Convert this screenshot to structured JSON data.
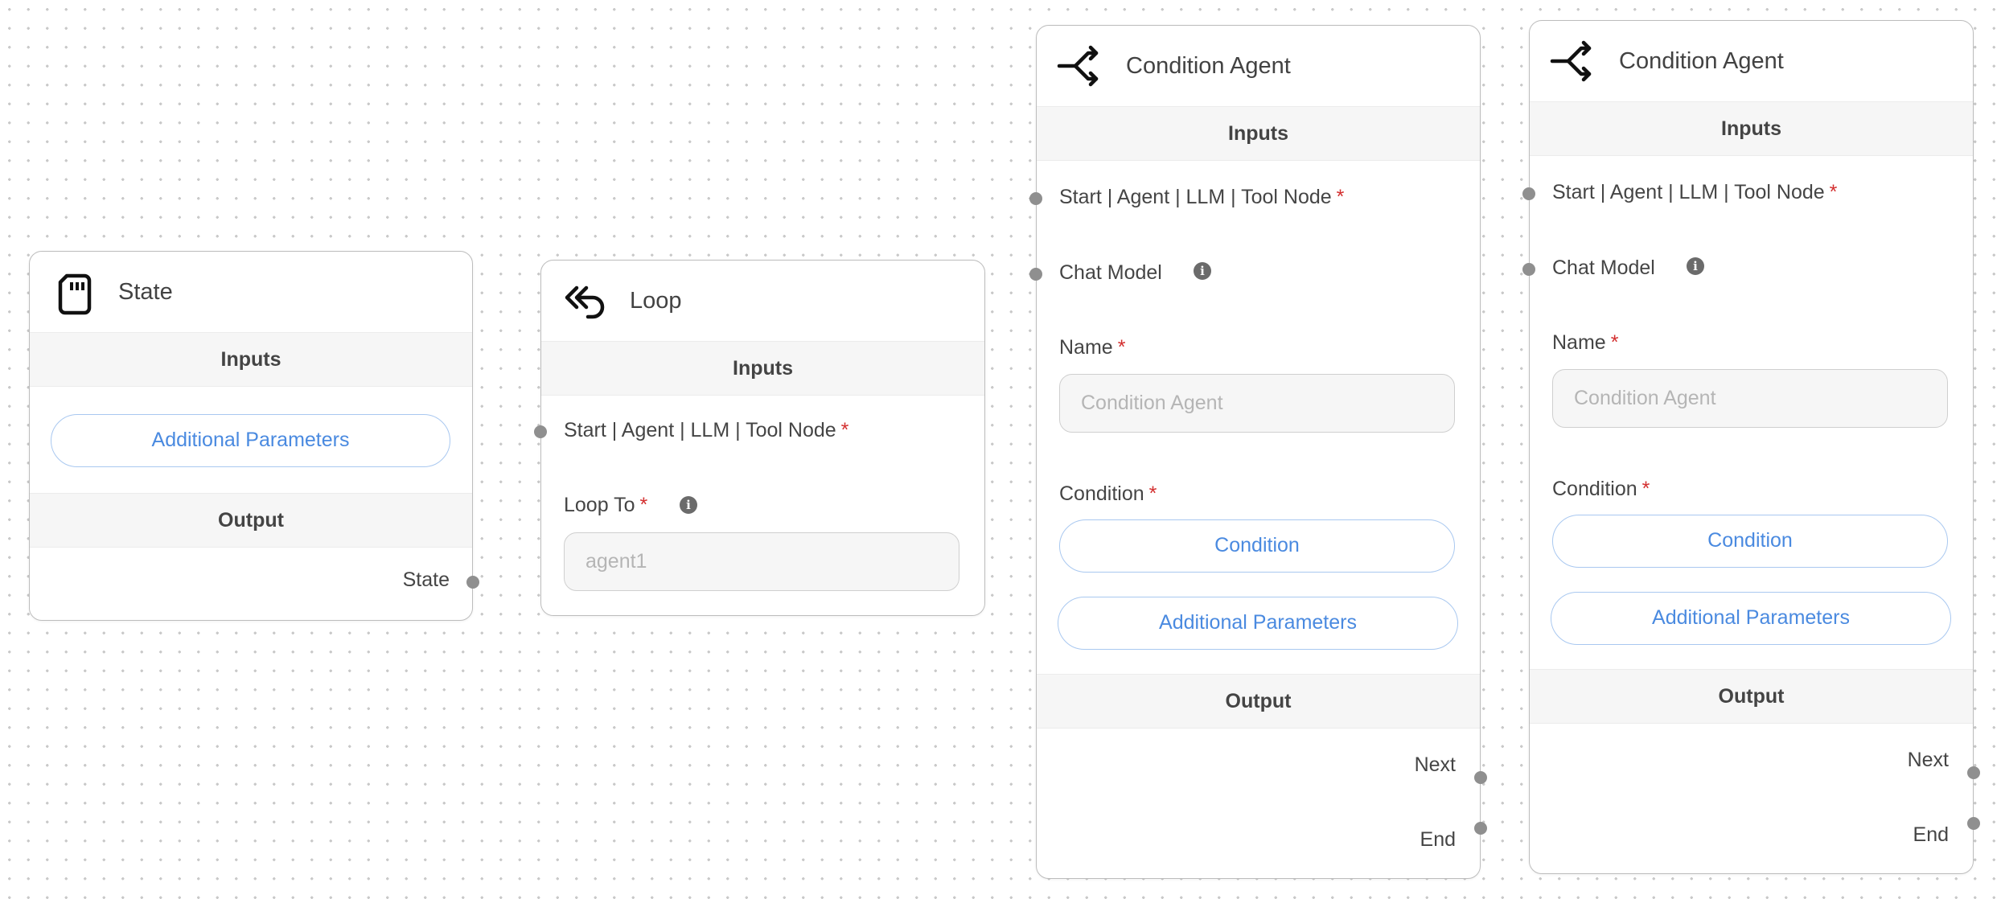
{
  "state_node": {
    "title": "State",
    "icon": "sd-card-icon",
    "inputs_header": "Inputs",
    "additional_params": "Additional Parameters",
    "output_header": "Output",
    "output_label": "State"
  },
  "loop_node": {
    "title": "Loop",
    "icon": "loop-back-icon",
    "inputs_header": "Inputs",
    "input_label": "Start | Agent | LLM | Tool Node",
    "loop_to_label": "Loop To",
    "loop_to_placeholder": "agent1"
  },
  "condition_nodes": [
    {
      "title": "Condition Agent",
      "icon": "branch-icon",
      "inputs_header": "Inputs",
      "input_label": "Start | Agent | LLM | Tool Node",
      "chat_model_label": "Chat Model",
      "name_label": "Name",
      "name_placeholder": "Condition Agent",
      "condition_label": "Condition",
      "condition_button": "Condition",
      "additional_params": "Additional Parameters",
      "output_header": "Output",
      "output_next": "Next",
      "output_end": "End"
    },
    {
      "title": "Condition Agent",
      "icon": "branch-icon",
      "inputs_header": "Inputs",
      "input_label": "Start | Agent | LLM | Tool Node",
      "chat_model_label": "Chat Model",
      "name_label": "Name",
      "name_placeholder": "Condition Agent",
      "condition_label": "Condition",
      "condition_button": "Condition",
      "additional_params": "Additional Parameters",
      "output_header": "Output",
      "output_next": "Next",
      "output_end": "End"
    }
  ],
  "required_marker": "*",
  "info_glyph": "i",
  "colors": {
    "accent_blue": "#4a8ae0",
    "required_red": "#d32f2f",
    "handle_gray": "#8f8f8f"
  }
}
